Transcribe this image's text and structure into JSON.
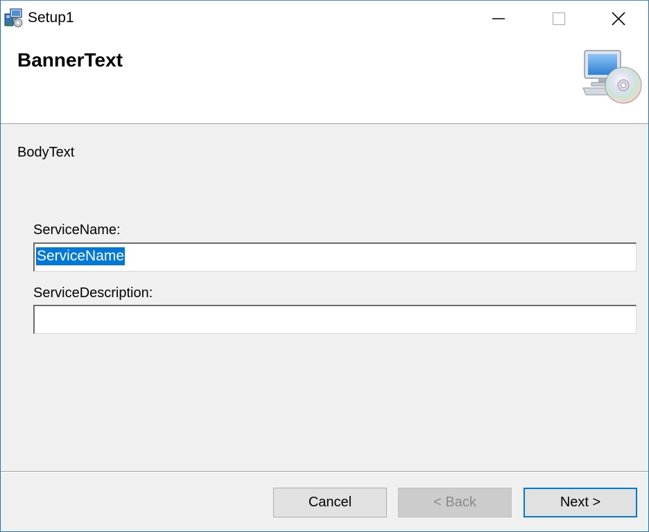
{
  "window": {
    "title": "Setup1",
    "app_icon": "installer-icon",
    "controls": {
      "minimize": "minimize-icon",
      "maximize": "maximize-icon",
      "close": "close-icon"
    }
  },
  "banner": {
    "text": "BannerText",
    "image": "computer-cd-icon"
  },
  "body": {
    "text": "BodyText"
  },
  "fields": {
    "service_name": {
      "label": "ServiceName:",
      "value": "ServiceName",
      "selected": true
    },
    "service_description": {
      "label": "ServiceDescription:",
      "value": ""
    }
  },
  "buttons": {
    "cancel": "Cancel",
    "back": "< Back",
    "back_enabled": false,
    "next": "Next >",
    "next_default": true
  },
  "colors": {
    "accent": "#0078d7",
    "selection": "#0078d7",
    "window_bg": "#f0f0f0",
    "banner_bg": "#ffffff"
  }
}
